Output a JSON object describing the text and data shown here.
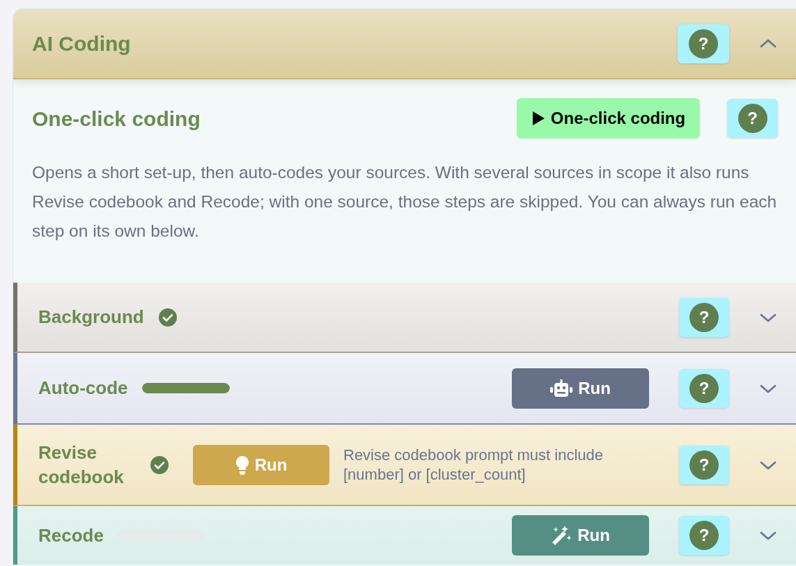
{
  "panel": {
    "title": "AI Coding",
    "expanded": true,
    "help": "?"
  },
  "one_click": {
    "heading": "One-click coding",
    "button": "One-click coding",
    "help": "?",
    "description": "Opens a short set-up, then auto-codes your sources. With several sources in scope it also runs Revise codebook and Recode; with one source, those steps are skipped. You can always run each step on its own below."
  },
  "steps": [
    {
      "kind": "background",
      "title": "Background",
      "done": true,
      "help": "?",
      "expanded": false
    },
    {
      "kind": "autocode",
      "title": "Auto-code",
      "done": false,
      "level": 1,
      "run": "Run",
      "help": "?",
      "expanded": false
    },
    {
      "kind": "revise",
      "title": "Revise codebook",
      "done": true,
      "run": "Run",
      "note": "Revise codebook prompt must include [number] or [cluster_count]",
      "help": "?",
      "expanded": false
    },
    {
      "kind": "recode",
      "title": "Recode",
      "done": false,
      "level": 0,
      "run": "Run",
      "help": "?",
      "expanded": false
    }
  ]
}
